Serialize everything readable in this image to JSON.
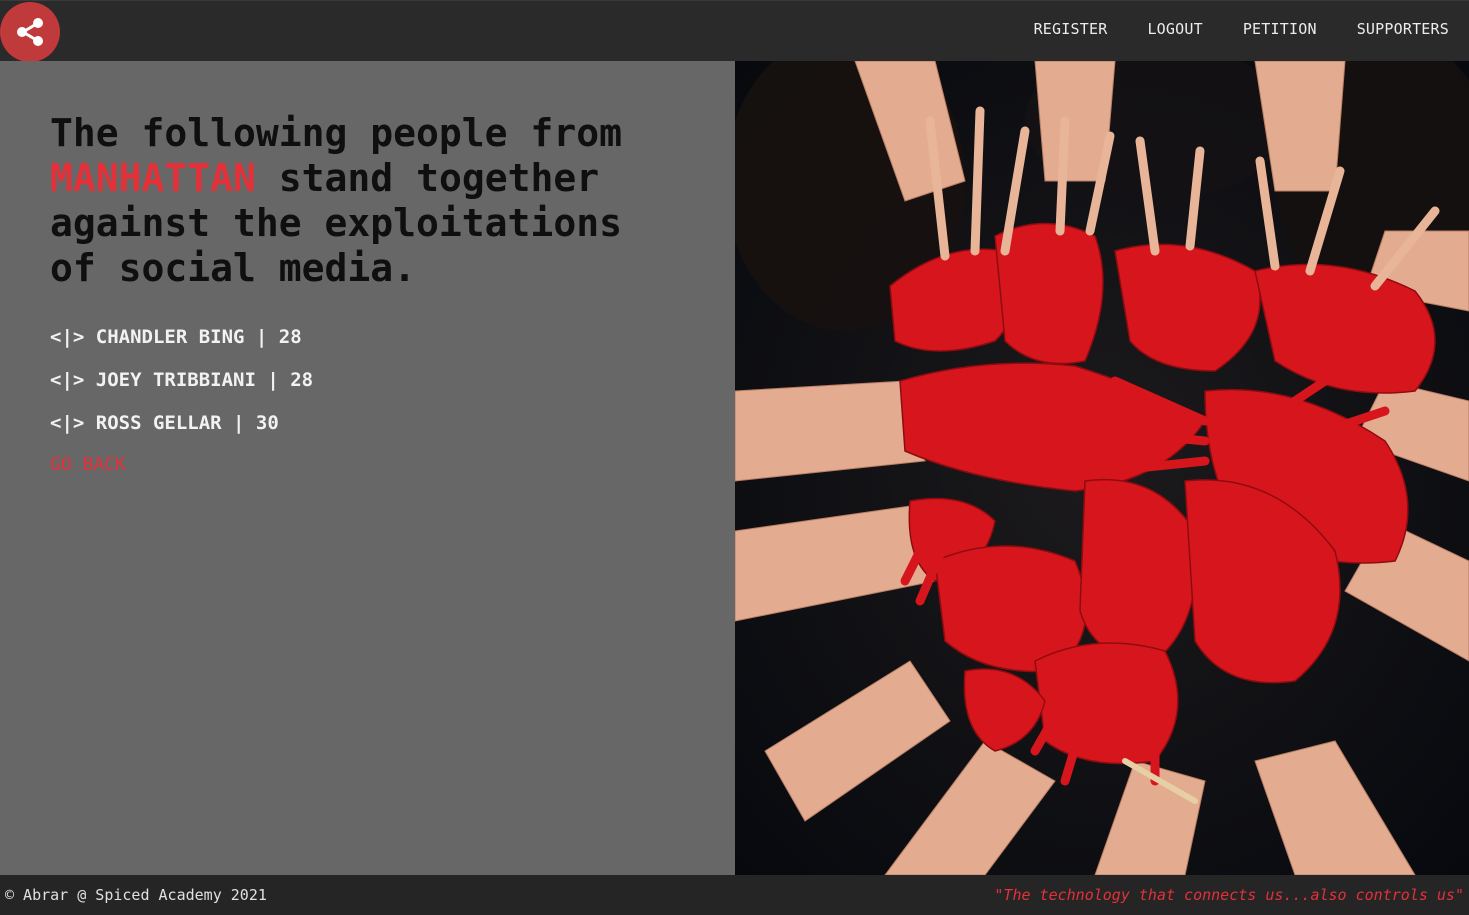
{
  "header": {
    "logo_icon": "share-icon",
    "nav": [
      {
        "label": "REGISTER"
      },
      {
        "label": "LOGOUT"
      },
      {
        "label": "PETITION"
      },
      {
        "label": "SUPPORTERS"
      }
    ]
  },
  "main": {
    "headline_before": "The following people from",
    "city": "MANHATTAN",
    "headline_after": "stand together against the exploitations of social media.",
    "signers": [
      {
        "text": "<|> CHANDLER BING | 28"
      },
      {
        "text": "<|> JOEY TRIBBIANI | 28"
      },
      {
        "text": "<|> ROSS GELLAR | 30"
      }
    ],
    "go_back": "GO BACK"
  },
  "footer": {
    "copyright": "© Abrar @ Spiced Academy 2021",
    "quote": "\"The technology that connects us...also controls us\""
  },
  "colors": {
    "accent": "#e3313a",
    "header_bg": "#2a2a2a",
    "panel_bg": "#676767"
  }
}
